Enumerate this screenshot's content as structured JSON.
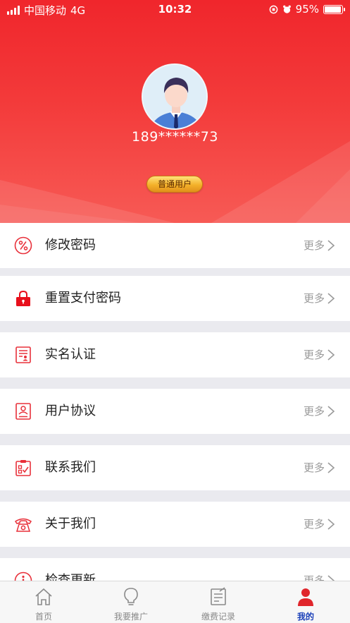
{
  "status_bar": {
    "carrier": "中国移动",
    "network": "4G",
    "time": "10:32",
    "battery": "95%",
    "battery_level": 0.95
  },
  "profile": {
    "phone": "189******73",
    "badge": "普通用户"
  },
  "menu": {
    "more_label": "更多",
    "items": [
      {
        "label": "修改密码",
        "icon": "percent-circle-icon"
      },
      {
        "label": "重置支付密码",
        "icon": "lock-icon"
      },
      {
        "label": "实名认证",
        "icon": "id-card-icon"
      },
      {
        "label": "用户协议",
        "icon": "user-document-icon"
      },
      {
        "label": "联系我们",
        "icon": "clipboard-check-icon"
      },
      {
        "label": "关于我们",
        "icon": "telephone-icon"
      },
      {
        "label": "检查更新",
        "icon": "info-icon"
      }
    ]
  },
  "tabbar": {
    "tabs": [
      {
        "label": "首页",
        "icon": "home-icon"
      },
      {
        "label": "我要推广",
        "icon": "lightbulb-icon"
      },
      {
        "label": "缴费记录",
        "icon": "record-icon"
      },
      {
        "label": "我的",
        "icon": "person-icon"
      }
    ],
    "active_index": 3
  },
  "colors": {
    "brand_red": "#f0262c",
    "active_tab": "#1a3fb8",
    "icon_red": "#e8303a"
  }
}
